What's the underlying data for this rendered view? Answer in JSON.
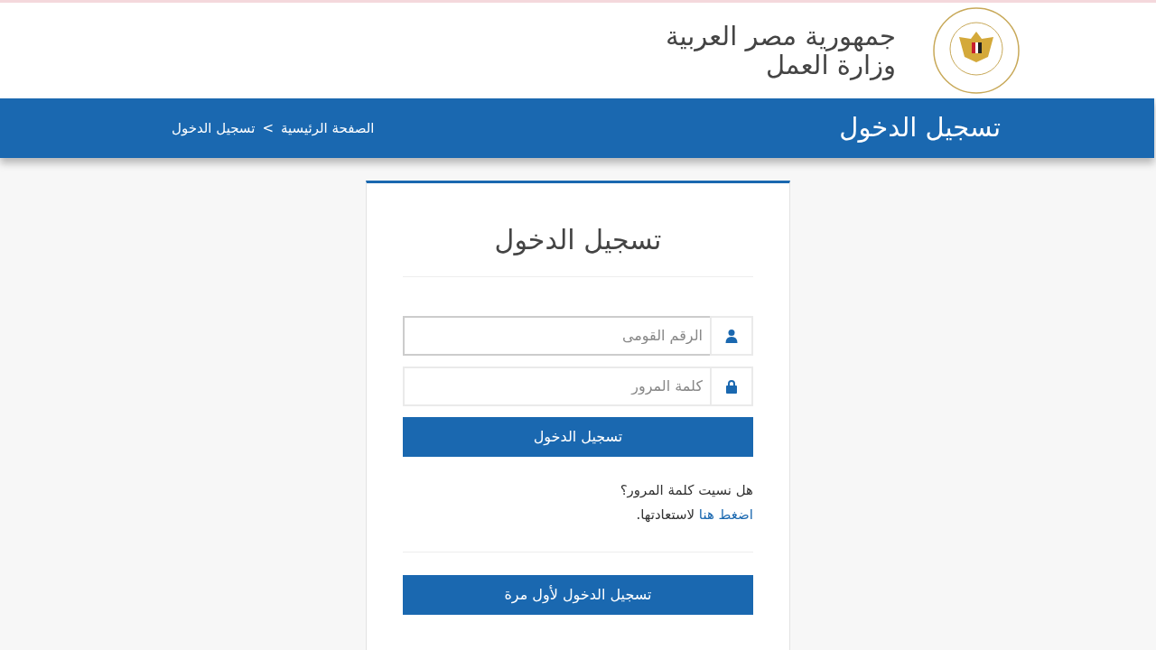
{
  "header": {
    "title_lines": [
      "جمهورية مصر العربية",
      "وزارة العمل"
    ]
  },
  "banner": {
    "title": "تسجيل الدخول",
    "breadcrumb": [
      {
        "label": "الصفحة الرئيسية"
      },
      {
        "label": "تسجيل الدخول"
      }
    ],
    "separator": ">"
  },
  "login_card": {
    "title": "تسجيل الدخول",
    "fields": [
      {
        "kind": "user",
        "placeholder": "الرقم القومى",
        "focused": true
      },
      {
        "kind": "lock",
        "placeholder": "كلمة المرور",
        "focused": false
      }
    ],
    "submit": "تسجيل الدخول",
    "forgot": {
      "question": "هل نسيت كلمة المرور؟",
      "link": "اضغط هنا",
      "rest": "لاستعادتها."
    },
    "first_time": "تسجيل الدخول لأول مرة"
  }
}
